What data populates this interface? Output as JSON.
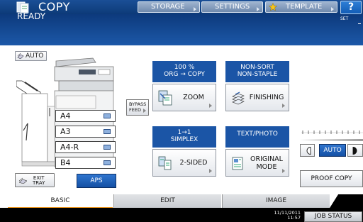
{
  "header": {
    "title": "COPY",
    "storage_label": "STORAGE",
    "settings_label": "SETTINGS",
    "template_label": "TEMPLATE",
    "help_label": "?"
  },
  "status": {
    "message": "READY",
    "set_label": "SET"
  },
  "left_panel": {
    "auto_label": "AUTO",
    "trays": [
      "A4",
      "A3",
      "A4-R",
      "B4"
    ],
    "bypass_label_1": "BYPASS",
    "bypass_label_2": "FEED",
    "exit_tray_label_1": "EXIT",
    "exit_tray_label_2": "TRAY",
    "aps_label": "APS"
  },
  "functions": {
    "ratio_line1": "100 %",
    "ratio_line2": "ORG → COPY",
    "zoom_label": "ZOOM",
    "finish_line1": "NON-SORT",
    "finish_line2": "NON-STAPLE",
    "finishing_label": "FINISHING",
    "duplex_line1": "1→1",
    "duplex_line2": "SIMPLEX",
    "two_sided_label": "2-SIDED",
    "mode_line1": "TEXT/PHOTO",
    "original_mode_label_1": "ORIGINAL",
    "original_mode_label_2": "MODE"
  },
  "density": {
    "auto_label": "AUTO",
    "proof_copy_label": "PROOF COPY"
  },
  "tabs": {
    "basic": "BASIC",
    "edit": "EDIT",
    "image": "IMAGE"
  },
  "footer": {
    "date": "11/11/2011",
    "time": "11:57",
    "job_status_label": "JOB STATUS"
  },
  "colors": {
    "title_bar": "#1a4f96",
    "status_bar": "#123f82",
    "function_header": "#1b55a6",
    "active_tab_accent": "#f39a1e"
  }
}
